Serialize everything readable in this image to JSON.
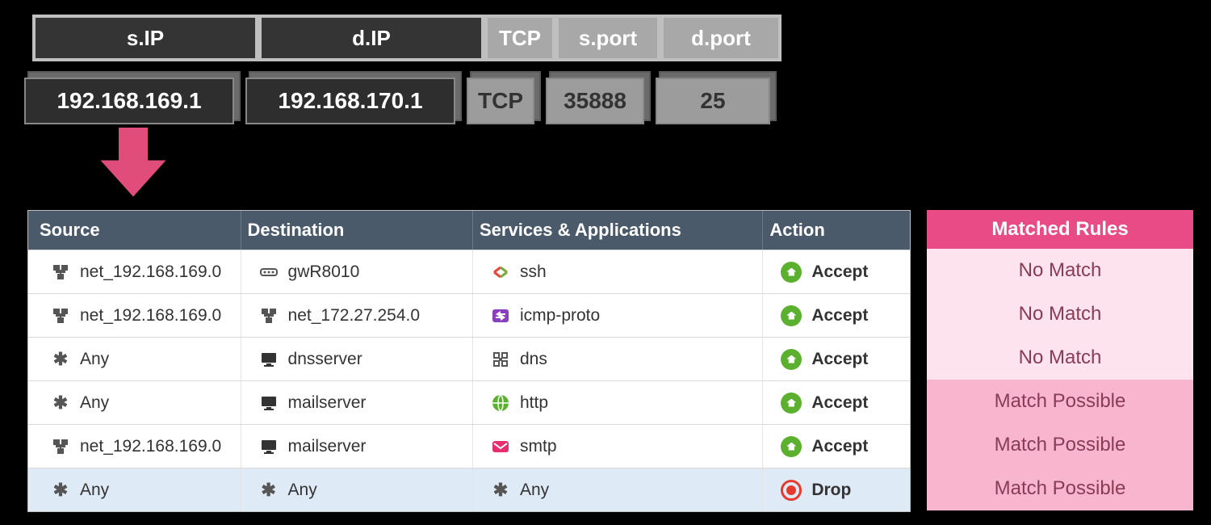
{
  "packet_header": {
    "labels": {
      "sip": "s.IP",
      "dip": "d.IP",
      "proto": "TCP",
      "sport": "s.port",
      "dport": "d.port"
    },
    "values": {
      "sip": "192.168.169.1",
      "dip": "192.168.170.1",
      "proto": "TCP",
      "sport": "35888",
      "dport": "25"
    }
  },
  "rules_table": {
    "columns": {
      "source": "Source",
      "destination": "Destination",
      "services": "Services & Applications",
      "action": "Action"
    },
    "rows": [
      {
        "source": {
          "icon": "network",
          "text": "net_192.168.169.0"
        },
        "destination": {
          "icon": "gateway",
          "text": "gwR8010"
        },
        "service": {
          "icon": "ssh",
          "text": "ssh"
        },
        "action": {
          "type": "accept",
          "text": "Accept"
        }
      },
      {
        "source": {
          "icon": "network",
          "text": "net_192.168.169.0"
        },
        "destination": {
          "icon": "network",
          "text": "net_172.27.254.0"
        },
        "service": {
          "icon": "icmp",
          "text": "icmp-proto"
        },
        "action": {
          "type": "accept",
          "text": "Accept"
        }
      },
      {
        "source": {
          "icon": "any",
          "text": "Any"
        },
        "destination": {
          "icon": "host",
          "text": "dnsserver"
        },
        "service": {
          "icon": "dns",
          "text": "dns"
        },
        "action": {
          "type": "accept",
          "text": "Accept"
        }
      },
      {
        "source": {
          "icon": "any",
          "text": "Any"
        },
        "destination": {
          "icon": "host",
          "text": "mailserver"
        },
        "service": {
          "icon": "http",
          "text": "http"
        },
        "action": {
          "type": "accept",
          "text": "Accept"
        }
      },
      {
        "source": {
          "icon": "network",
          "text": "net_192.168.169.0"
        },
        "destination": {
          "icon": "host",
          "text": "mailserver"
        },
        "service": {
          "icon": "smtp",
          "text": "smtp"
        },
        "action": {
          "type": "accept",
          "text": "Accept"
        }
      },
      {
        "source": {
          "icon": "any",
          "text": "Any"
        },
        "destination": {
          "icon": "any",
          "text": "Any"
        },
        "service": {
          "icon": "any",
          "text": "Any"
        },
        "action": {
          "type": "drop",
          "text": "Drop"
        }
      }
    ]
  },
  "matched": {
    "header": "Matched Rules",
    "rows": [
      {
        "text": "No Match",
        "class": "m-no"
      },
      {
        "text": "No Match",
        "class": "m-no"
      },
      {
        "text": "No Match",
        "class": "m-no"
      },
      {
        "text": "Match Possible",
        "class": "m-poss"
      },
      {
        "text": "Match Possible",
        "class": "m-poss"
      },
      {
        "text": "Match Possible",
        "class": "m-poss"
      }
    ]
  }
}
